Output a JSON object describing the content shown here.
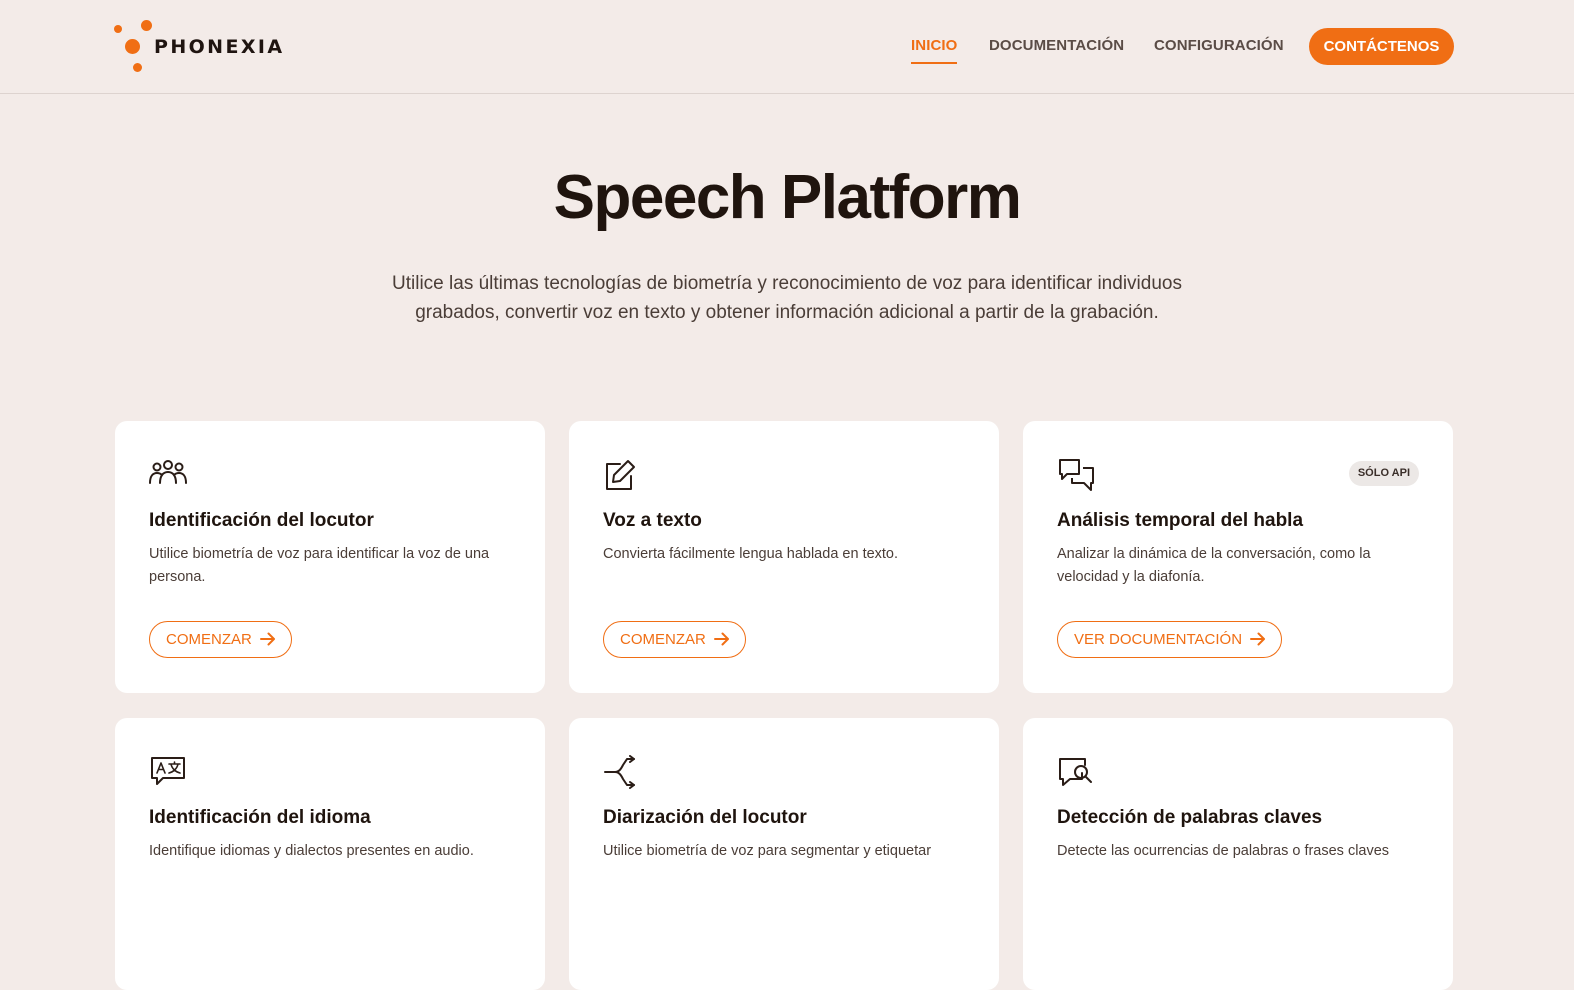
{
  "header": {
    "logo_text": "PHONEXIA",
    "nav": [
      {
        "label": "INICIO",
        "active": true
      },
      {
        "label": "DOCUMENTACIÓN",
        "active": false
      },
      {
        "label": "CONFIGURACIÓN",
        "active": false
      }
    ],
    "cta_label": "CONTÁCTENOS"
  },
  "hero": {
    "title": "Speech Platform",
    "subtitle": "Utilice las últimas tecnologías de biometría y reconocimiento de voz para identificar individuos grabados, convertir voz en texto y obtener información adicional a partir de la grabación."
  },
  "cards": [
    {
      "icon": "users-icon",
      "title": "Identificación del locutor",
      "description": "Utilice biometría de voz para identificar la voz de una persona.",
      "button": "COMENZAR"
    },
    {
      "icon": "edit-icon",
      "title": "Voz a texto",
      "description": "Convierta fácilmente lengua hablada en texto.",
      "button": "COMENZAR"
    },
    {
      "icon": "chat-icon",
      "title": "Análisis temporal del habla",
      "description": "Analizar la dinámica de la conversación, como la velocidad y la diafonía.",
      "button": "VER DOCUMENTACIÓN",
      "badge": "SÓLO API"
    },
    {
      "icon": "translate-icon",
      "title": "Identificación del idioma",
      "description": "Identifique idiomas y dialectos presentes en audio.",
      "button": ""
    },
    {
      "icon": "split-icon",
      "title": "Diarización del locutor",
      "description": "Utilice biometría de voz para segmentar y etiquetar",
      "button": ""
    },
    {
      "icon": "chat-search-icon",
      "title": "Detección de palabras claves",
      "description": "Detecte las ocurrencias de palabras o frases claves",
      "button": ""
    }
  ],
  "colors": {
    "accent": "#f06e14",
    "background": "#f3ebe8",
    "card": "#ffffff",
    "text": "#1f140e"
  }
}
